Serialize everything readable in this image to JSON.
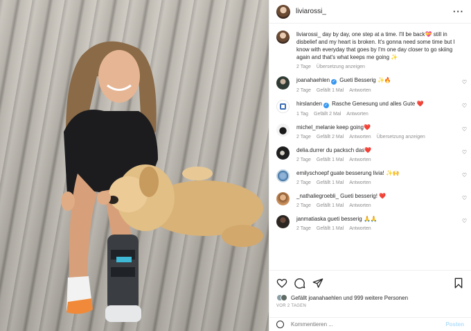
{
  "post": {
    "username": "liviarossi_",
    "more_icon": "more-dots-icon"
  },
  "caption": {
    "username": "liviarossi_",
    "text": "day by day, one step at a time. I'll be back💝 still in disbelief and my heart is broken. It's gonna need some time but I know with everyday that goes by I'm one day closer to go skiing again and that's what keeps me going ✨",
    "time": "2 Tage",
    "translate": "Übersetzung anzeigen"
  },
  "comments": [
    {
      "username": "joanahaehlen",
      "verified": true,
      "text": "Gueti Besserig ✨🔥",
      "time": "2 Tage",
      "likes": "Gefällt 1 Mal",
      "reply": "Antworten",
      "translate": ""
    },
    {
      "username": "hirslanden",
      "verified": true,
      "text": "Rasche Genesung und alles Gute ❤️",
      "time": "1 Tag",
      "likes": "Gefällt 2 Mal",
      "reply": "Antworten",
      "translate": ""
    },
    {
      "username": "michel_melanie",
      "verified": false,
      "text": "keep going❤️",
      "time": "2 Tage",
      "likes": "Gefällt 2 Mal",
      "reply": "Antworten",
      "translate": "Übersetzung anzeigen"
    },
    {
      "username": "delia.durrer",
      "verified": false,
      "text": "du packsch das❤️",
      "time": "2 Tage",
      "likes": "Gefällt 1 Mal",
      "reply": "Antworten",
      "translate": ""
    },
    {
      "username": "emilyschoepf",
      "verified": false,
      "text": "guate besserung livia! ✨🙌",
      "time": "2 Tage",
      "likes": "Gefällt 1 Mal",
      "reply": "Antworten",
      "translate": ""
    },
    {
      "username": "_nathaliegroebli_",
      "verified": false,
      "text": "Gueti besserig! ❤️",
      "time": "2 Tage",
      "likes": "Gefällt 1 Mal",
      "reply": "Antworten",
      "translate": ""
    },
    {
      "username": "janmatiaska",
      "verified": false,
      "text": "gueti besserig 🙏🙏",
      "time": "2 Tage",
      "likes": "Gefällt 1 Mal",
      "reply": "Antworten",
      "translate": ""
    }
  ],
  "likes": {
    "text": "Gefällt joanahaehlen und 999 weitere Personen"
  },
  "date": "VOR 2 TAGEN",
  "add_comment": {
    "placeholder": "Kommentieren ...",
    "post_label": "Posten"
  },
  "icons": {
    "like": "heart-icon",
    "comment": "comment-bubble-icon",
    "share": "paper-plane-icon",
    "save": "bookmark-icon",
    "emoji": "emoji-smiley-icon"
  },
  "colors": {
    "link_blue": "#3897f0",
    "muted": "#8e8e8e",
    "post_button": "#b2dffc"
  }
}
